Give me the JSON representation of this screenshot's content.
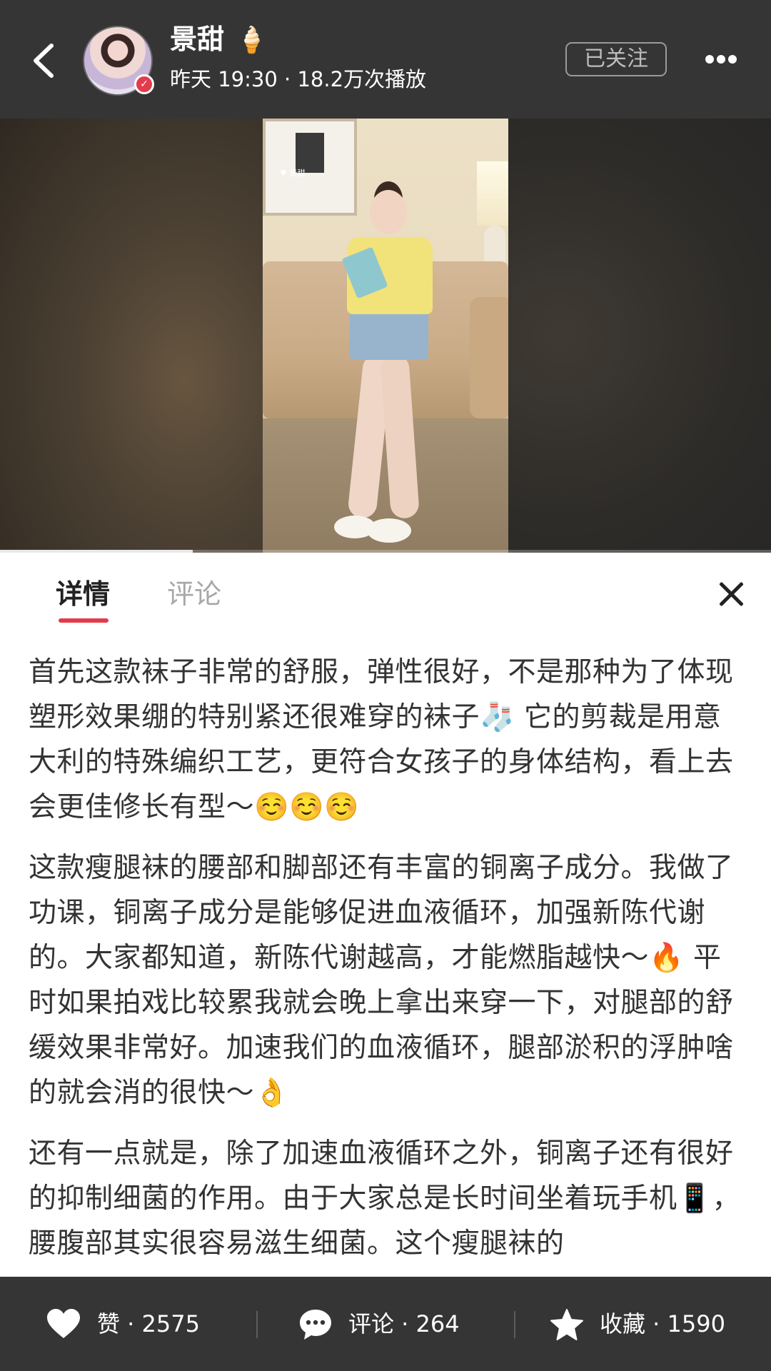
{
  "header": {
    "username": "景甜",
    "name_emoji": "🍦",
    "meta": "昨天 19:30 · 18.2万次播放",
    "follow_label": "已关注"
  },
  "video": {
    "watermark_name": "景甜",
    "progress": 0.25
  },
  "tabs": [
    {
      "label": "详情",
      "active": true
    },
    {
      "label": "评论",
      "active": false
    }
  ],
  "content": {
    "paragraphs": [
      "首先这款袜子非常的舒服，弹性很好，不是那种为了体现塑形效果绷的特别紧还很难穿的袜子🧦 它的剪裁是用意大利的特殊编织工艺，更符合女孩子的身体结构，看上去会更佳修长有型～☺️☺️☺️",
      "这款瘦腿袜的腰部和脚部还有丰富的铜离子成分。我做了功课，铜离子成分是能够促进血液循环，加强新陈代谢的。大家都知道，新陈代谢越高，才能燃脂越快～🔥 平时如果拍戏比较累我就会晚上拿出来穿一下，对腿部的舒缓效果非常好。加速我们的血液循环，腿部淤积的浮肿啥的就会消的很快～👌",
      "还有一点就是，除了加速血液循环之外，铜离子还有很好的抑制细菌的作用。由于大家总是长时间坐着玩手机📱，腰腹部其实很容易滋生细菌。这个瘦腿袜的"
    ]
  },
  "bottom_bar": {
    "like_label": "赞 · 2575",
    "comment_label": "评论 · 264",
    "favorite_label": "收藏 · 1590"
  },
  "colors": {
    "header_bg": "#353535",
    "accent": "#e23b4a"
  },
  "icons": [
    "back-arrow-icon",
    "verified-icon",
    "more-icon",
    "close-icon",
    "heart-icon",
    "comment-icon",
    "star-icon"
  ]
}
